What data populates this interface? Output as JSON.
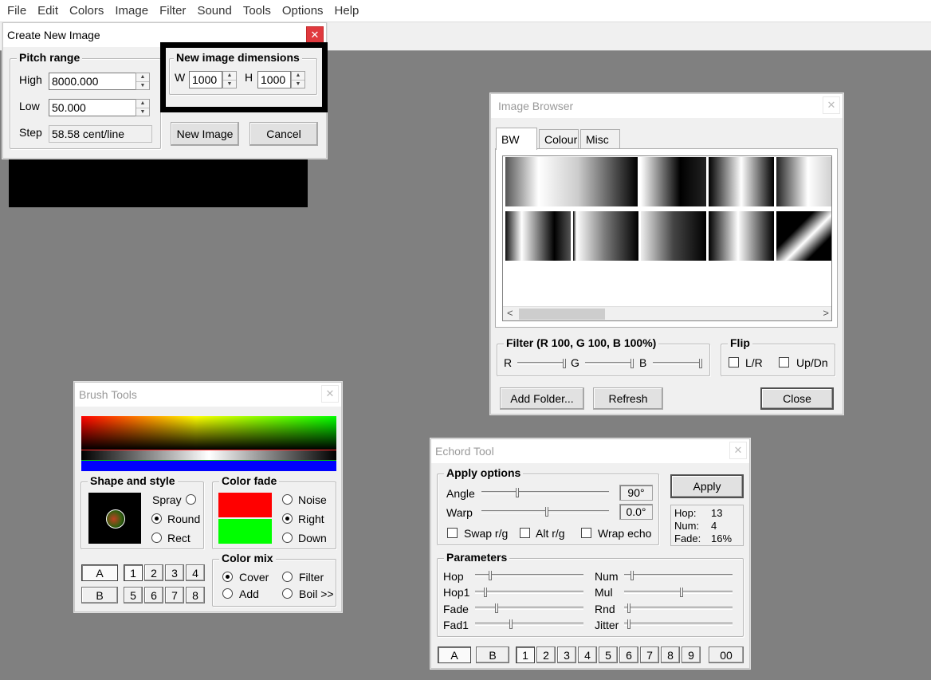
{
  "menu": [
    "File",
    "Edit",
    "Colors",
    "Image",
    "Filter",
    "Sound",
    "Tools",
    "Options",
    "Help"
  ],
  "create_dialog": {
    "title": "Create New Image",
    "close_glyph": "✕",
    "pitch_group": "Pitch range",
    "high_label": "High",
    "high_value": "8000.000",
    "low_label": "Low",
    "low_value": "50.000",
    "step_label": "Step",
    "step_value": "58.58 cent/line",
    "dims_group": "New image dimensions",
    "w_label": "W",
    "w_value": "1000",
    "h_label": "H",
    "h_value": "1000",
    "new_image_button": "New Image",
    "cancel_button": "Cancel"
  },
  "image_browser": {
    "title": "Image Browser",
    "tabs": [
      "BW",
      "Colour",
      "Misc"
    ],
    "active_tab": "BW",
    "filter_group": "Filter (R 100, G 100, B 100%)",
    "filter_labels": [
      "R",
      "G",
      "B"
    ],
    "flip_group": "Flip",
    "flip_lr": "L/R",
    "flip_updn": "Up/Dn",
    "add_folder_button": "Add Folder...",
    "refresh_button": "Refresh",
    "close_button": "Close",
    "scroll_left": "<",
    "scroll_right": ">"
  },
  "brush_tools": {
    "title": "Brush Tools",
    "shape_group": "Shape and style",
    "spray_label": "Spray",
    "round_label": "Round",
    "rect_label": "Rect",
    "selected_shape": "Round",
    "fade_group": "Color fade",
    "noise_label": "Noise",
    "right_label": "Right",
    "down_label": "Down",
    "selected_fade": "Right",
    "fade_colors": [
      "#ff0000",
      "#00ff00"
    ],
    "mix_group": "Color mix",
    "cover_label": "Cover",
    "add_label": "Add",
    "filter_label": "Filter",
    "boil_label": "Boil >>",
    "selected_mix": "Cover",
    "slot_a": "A",
    "slot_b": "B",
    "numbers_top": [
      "1",
      "2",
      "3",
      "4"
    ],
    "numbers_bottom": [
      "5",
      "6",
      "7",
      "8"
    ]
  },
  "echord_tool": {
    "title": "Echord Tool",
    "apply_group": "Apply options",
    "angle_label": "Angle",
    "angle_value": "90°",
    "warp_label": "Warp",
    "warp_value": "0.0°",
    "swap_label": "Swap r/g",
    "alt_label": "Alt r/g",
    "wrap_label": "Wrap echo",
    "apply_button": "Apply",
    "hop_stat_label": "Hop:",
    "hop_stat_value": "13",
    "num_stat_label": "Num:",
    "num_stat_value": "4",
    "fade_stat_label": "Fade:",
    "fade_stat_value": "16%",
    "params_group": "Parameters",
    "param_left": [
      "Hop",
      "Hop1",
      "Fade",
      "Fad1"
    ],
    "param_right": [
      "Num",
      "Mul",
      "Rnd",
      "Jitter"
    ],
    "slot_a": "A",
    "slot_b": "B",
    "numbers": [
      "1",
      "2",
      "3",
      "4",
      "5",
      "6",
      "7",
      "8",
      "9"
    ],
    "zero_button": "00"
  }
}
